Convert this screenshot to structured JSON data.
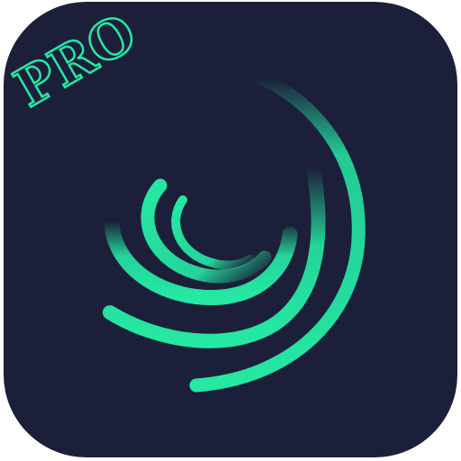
{
  "app_icon": {
    "badge_label": "PRO",
    "colors": {
      "tile_background": "#1c1f3a",
      "accent": "#25e8a3",
      "badge_stroke": "#25e8a3",
      "badge_fill": "#1c1f3a"
    },
    "icon_name": "swirl-arcs-icon"
  }
}
